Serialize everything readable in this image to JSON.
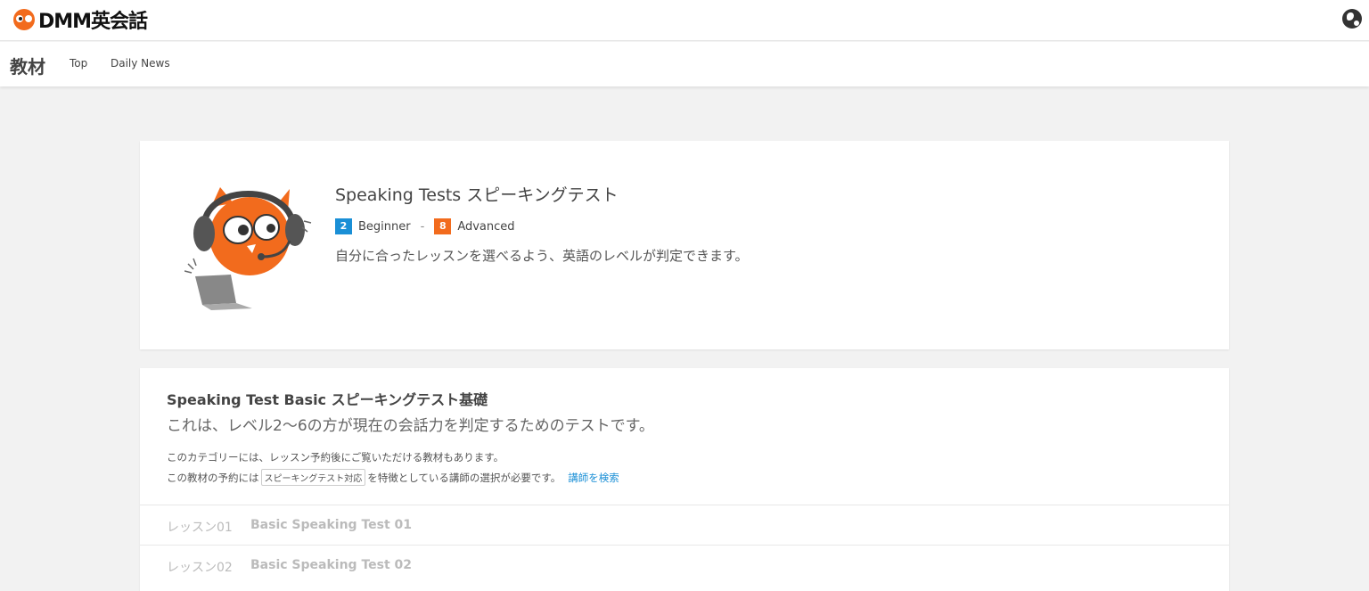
{
  "header": {
    "logo_text": "DMM英会話",
    "globe_icon": "globe-icon"
  },
  "subnav": {
    "section": "教材",
    "links": [
      "Top",
      "Daily News"
    ]
  },
  "hero": {
    "title": "Speaking Tests スピーキングテスト",
    "level_min": {
      "num": "2",
      "label": "Beginner",
      "color": "#1a8fd6"
    },
    "level_sep": "-",
    "level_max": {
      "num": "8",
      "label": "Advanced",
      "color": "#f26b1d"
    },
    "description": "自分に合ったレッスンを選べるよう、英語のレベルが判定できます。"
  },
  "course": {
    "title": "Speaking Test Basic スピーキングテスト基礎",
    "subtitle": "これは、レベル2〜6の方が現在の会話力を判定するためのテストです。",
    "note1": "このカテゴリーには、レッスン予約後にご覧いただける教材もあります。",
    "note2_before": "この教材の予約には",
    "note2_tag": "スピーキングテスト対応",
    "note2_after": "を特徴としている講師の選択が必要です。",
    "tutor_link": "講師を検索",
    "lessons": [
      {
        "num": "レッスン01",
        "name": "Basic Speaking Test 01"
      },
      {
        "num": "レッスン02",
        "name": "Basic Speaking Test 02"
      }
    ]
  },
  "colors": {
    "brand": "#f26b1d",
    "link": "#1a8fd6"
  }
}
